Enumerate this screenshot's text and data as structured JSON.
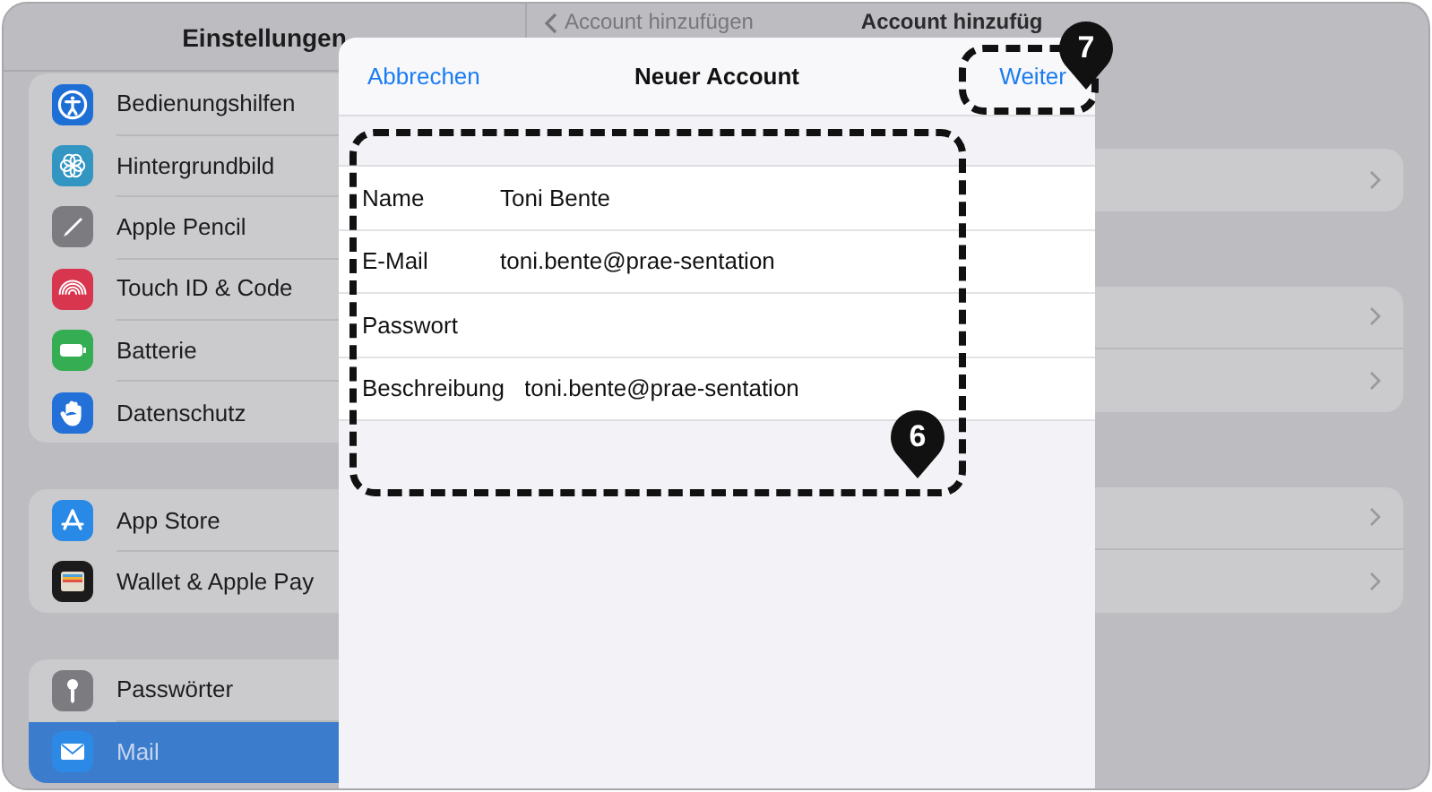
{
  "sidebar": {
    "title": "Einstellungen",
    "groups": [
      {
        "items": [
          {
            "label": "Bedienungshilfen",
            "color": "#1d6fd6",
            "selected": false
          },
          {
            "label": "Hintergrundbild",
            "color": "#3295c2",
            "selected": false
          },
          {
            "label": "Apple Pencil",
            "color": "#7b7b80",
            "selected": false
          },
          {
            "label": "Touch ID & Code",
            "color": "#d8364f",
            "selected": false
          },
          {
            "label": "Batterie",
            "color": "#35ad52",
            "selected": false
          },
          {
            "label": "Datenschutz",
            "color": "#2270d8",
            "selected": false
          }
        ]
      },
      {
        "items": [
          {
            "label": "App Store",
            "color": "#2889e6",
            "selected": false
          },
          {
            "label": "Wallet & Apple Pay",
            "color": "#1b1b1b",
            "selected": false
          }
        ]
      },
      {
        "items": [
          {
            "label": "Passwörter",
            "color": "#7b7b80",
            "selected": false
          },
          {
            "label": "Mail",
            "color": "#2c8ae6",
            "selected": true
          }
        ]
      }
    ]
  },
  "detail": {
    "back": "Account hinzufügen",
    "title": "Account hinzufüg",
    "groups": [
      {
        "rows": [
          {
            "kind": "link"
          }
        ]
      },
      {
        "rows": [
          {
            "kind": "link"
          },
          {
            "kind": "link"
          }
        ]
      },
      {
        "rows": [
          {
            "kind": "link"
          },
          {
            "kind": "link"
          }
        ]
      }
    ]
  },
  "sheet": {
    "cancel": "Abbrechen",
    "title": "Neuer Account",
    "next": "Weiter",
    "fields": [
      {
        "label": "Name",
        "value": "Toni Bente"
      },
      {
        "label": "E-Mail",
        "value": "toni.bente@prae-sentation"
      },
      {
        "label": "Passwort"
      },
      {
        "label": "Beschreibung",
        "value": "toni.bente@prae-sentation"
      }
    ]
  },
  "callouts": [
    {
      "number": "6"
    },
    {
      "number": "7"
    }
  ]
}
